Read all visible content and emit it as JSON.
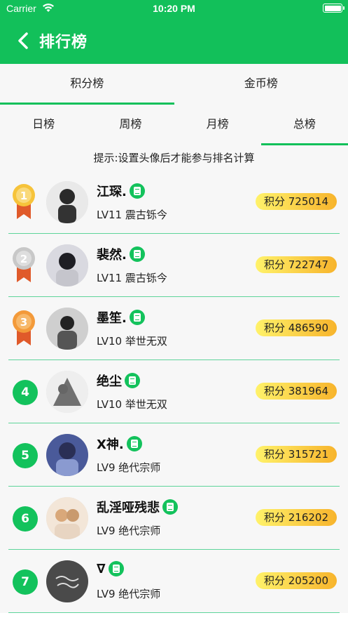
{
  "status_bar": {
    "carrier": "Carrier",
    "time": "10:20 PM"
  },
  "nav": {
    "title": "排行榜",
    "back_icon": "chevron-left-icon"
  },
  "main_tabs": [
    {
      "label": "积分榜",
      "active": true
    },
    {
      "label": "金币榜",
      "active": false
    }
  ],
  "sub_tabs": [
    {
      "label": "日榜",
      "active": false
    },
    {
      "label": "周榜",
      "active": false
    },
    {
      "label": "月榜",
      "active": false
    },
    {
      "label": "总榜",
      "active": true
    }
  ],
  "tip": "提示:设置头像后才能参与排名计算",
  "colors": {
    "primary": "#12c05a",
    "divider": "#5ed49a",
    "points_from": "#fff26a",
    "points_to": "#f7b42c"
  },
  "ranking": [
    {
      "rank": "1",
      "medal": "gold",
      "name": "江琛.",
      "level": "LV11 震古铄今",
      "points": "积分 725014"
    },
    {
      "rank": "2",
      "medal": "silver",
      "name": "裴然.",
      "level": "LV11 震古铄今",
      "points": "积分 722747"
    },
    {
      "rank": "3",
      "medal": "bronze",
      "name": "墨笙.",
      "level": "LV10 举世无双",
      "points": "积分 486590"
    },
    {
      "rank": "4",
      "medal": "",
      "name": "绝尘",
      "level": "LV10 举世无双",
      "points": "积分 381964"
    },
    {
      "rank": "5",
      "medal": "",
      "name": "X神.",
      "level": "LV9 绝代宗师",
      "points": "积分 315721"
    },
    {
      "rank": "6",
      "medal": "",
      "name": "乱淫哑残悲",
      "level": "LV9 绝代宗师",
      "points": "积分 216202"
    },
    {
      "rank": "7",
      "medal": "",
      "name": "∇",
      "level": "LV9 绝代宗师",
      "points": "积分 205200"
    }
  ]
}
